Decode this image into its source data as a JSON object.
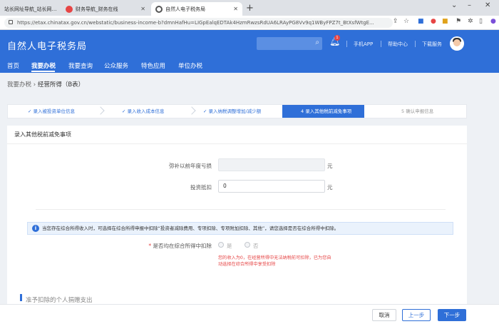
{
  "browser": {
    "tabs": [
      {
        "label": "站长网址导航_站长网…"
      },
      {
        "label": "财务导航_财务在线"
      },
      {
        "label": "自然人电子税务局"
      }
    ],
    "url": "https://etax.chinatax.gov.cn/webstatic/business-income-b?dmnHafHu=LIGpEalqEDTAk4HzmRwzsRdUA6LRAyPG8Vv9q1WByFPZ7t_BtXsfWtgE..."
  },
  "header": {
    "title": "自然人电子税务局",
    "badge_count": "1",
    "links": [
      "手机APP",
      "帮助中心",
      "下载服务"
    ]
  },
  "nav": {
    "items": [
      "首页",
      "我要办税",
      "我要查询",
      "公众服务",
      "特色应用",
      "单位办税"
    ],
    "active": "我要办税"
  },
  "breadcrumb": {
    "parent": "我要办税",
    "current": "经营所得（B表）"
  },
  "steps": [
    {
      "label": "✓ 录入被投资单位信息"
    },
    {
      "label": "✓ 录入收入成本信息"
    },
    {
      "label": "✓ 录入纳税调整增加/减少额"
    },
    {
      "label": "4  录入其他税前减免事项"
    },
    {
      "label": "5  确认申报信息"
    }
  ],
  "form": {
    "section_title": "录入其他税前减免事项",
    "loss_label": "弥补以前年度亏损",
    "loss_value": "",
    "invest_label": "投资抵扣",
    "invest_value": "0",
    "unit": "元",
    "info_text": "当您存在综合所得收入时，可选择在综合所得申报中扣除“投资者减除费用、专项扣除、专项附加扣除、其他”，请您选择是否在综合所得中扣除。",
    "deduct_label": "是否均在综合所得中扣除",
    "yes": "是",
    "no": "否",
    "warning": "您的收入为0，在经营所得中无法纳税前可扣除，已为您自动选择在综合所得中享受扣除",
    "subsection": "准予扣除的个人捐赠支出"
  },
  "footer": {
    "cancel": "取消",
    "prev": "上一步",
    "next": "下一步"
  }
}
